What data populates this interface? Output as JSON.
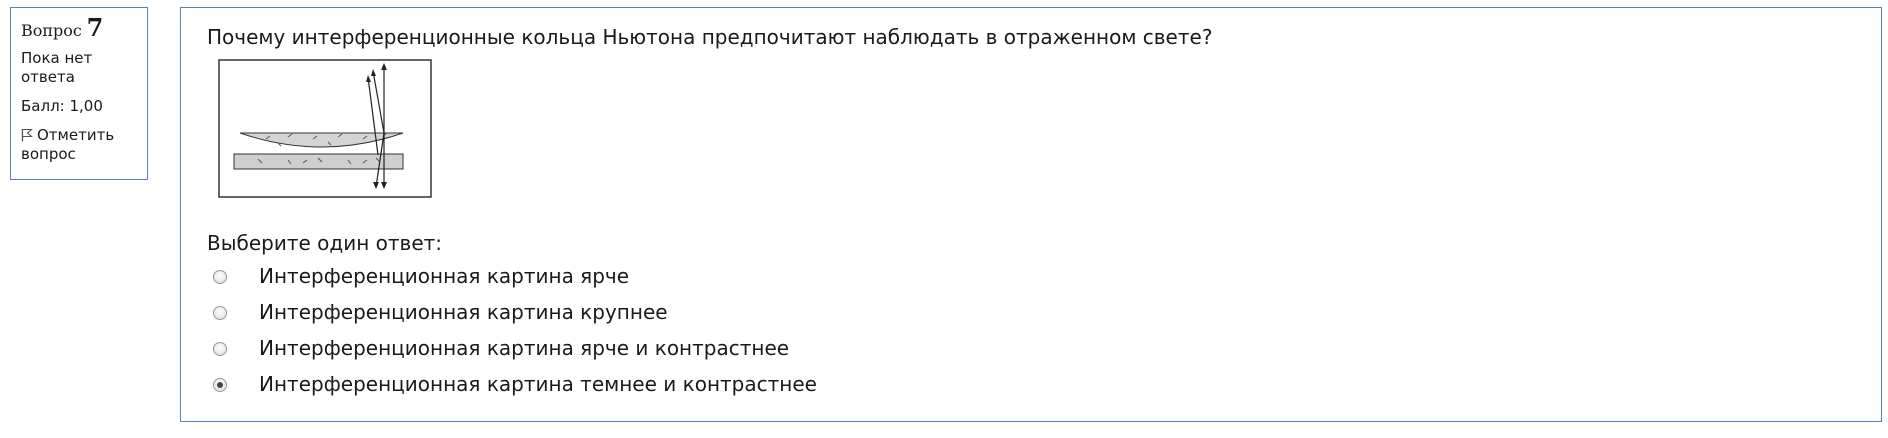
{
  "info": {
    "question_label": "Вопрос",
    "question_number": "7",
    "state": "Пока нет ответа",
    "grade": "Балл: 1,00",
    "flag_label": "Отметить вопрос"
  },
  "question": {
    "text": "Почему интерференционные кольца Ньютона предпочитают наблюдать в отраженном свете?",
    "prompt": "Выберите один ответ:",
    "options": [
      {
        "label": "Интерференционная картина ярче",
        "checked": false
      },
      {
        "label": "Интерференционная картина крупнее",
        "checked": false
      },
      {
        "label": "Интерференционная картина ярче и контрастнее",
        "checked": false
      },
      {
        "label": "Интерференционная картина темнее и контрастнее",
        "checked": true
      }
    ]
  },
  "colors": {
    "border": "#5b7fb0",
    "figure_fill": "#cfcfcf"
  }
}
